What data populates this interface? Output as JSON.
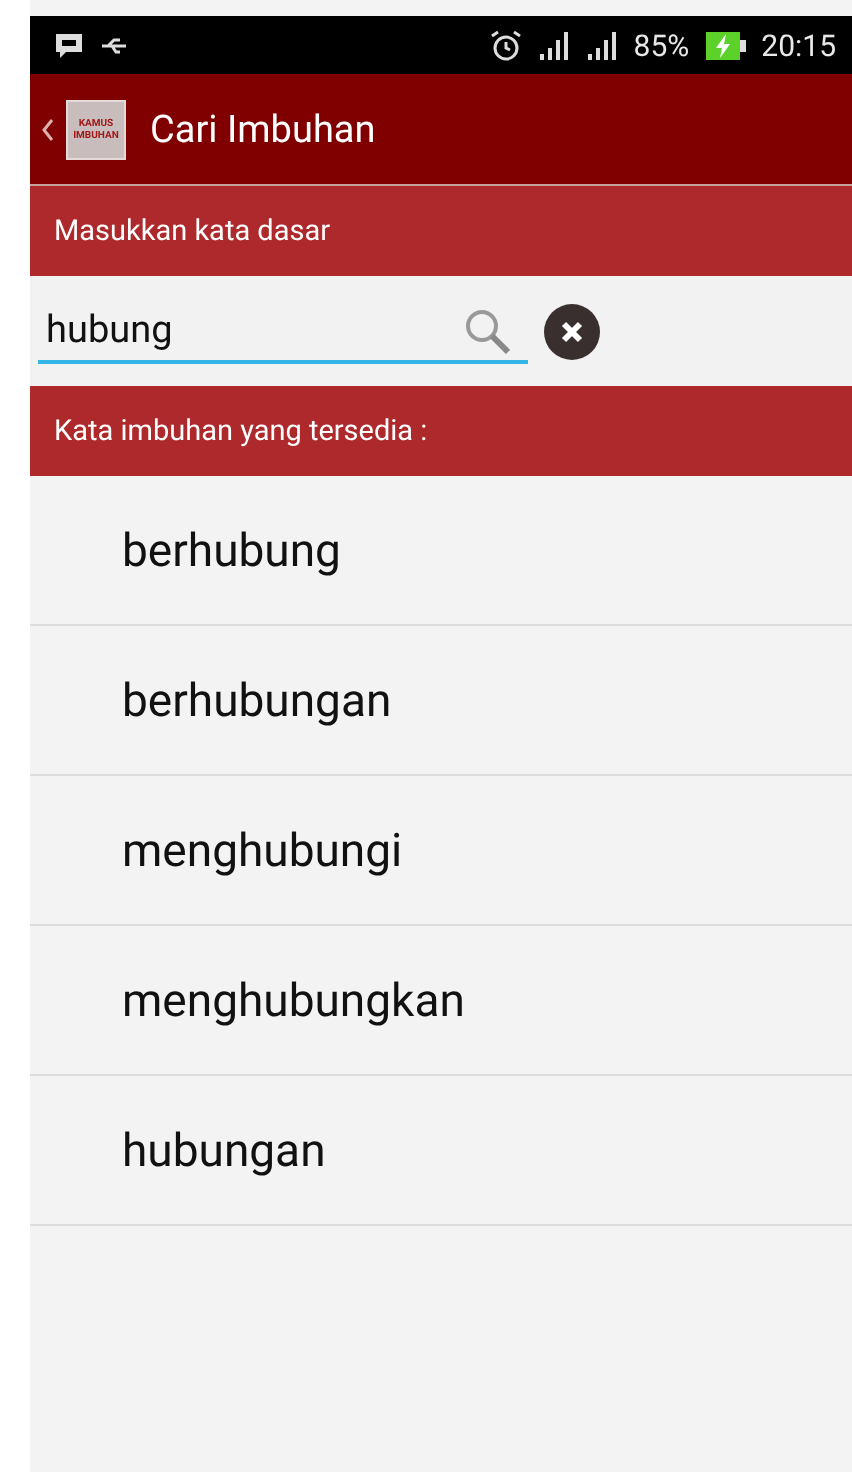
{
  "status_bar": {
    "battery": "85%",
    "time": "20:15"
  },
  "app_bar": {
    "logo_lines": [
      "KAMUS",
      "IMBUHAN"
    ],
    "title": "Cari Imbuhan"
  },
  "input_label": "Masukkan kata dasar",
  "search": {
    "value": "hubung"
  },
  "results_label": "Kata imbuhan yang tersedia :",
  "results": [
    "berhubung",
    "berhubungan",
    "menghubungi",
    "menghubungkan",
    "hubungan"
  ]
}
